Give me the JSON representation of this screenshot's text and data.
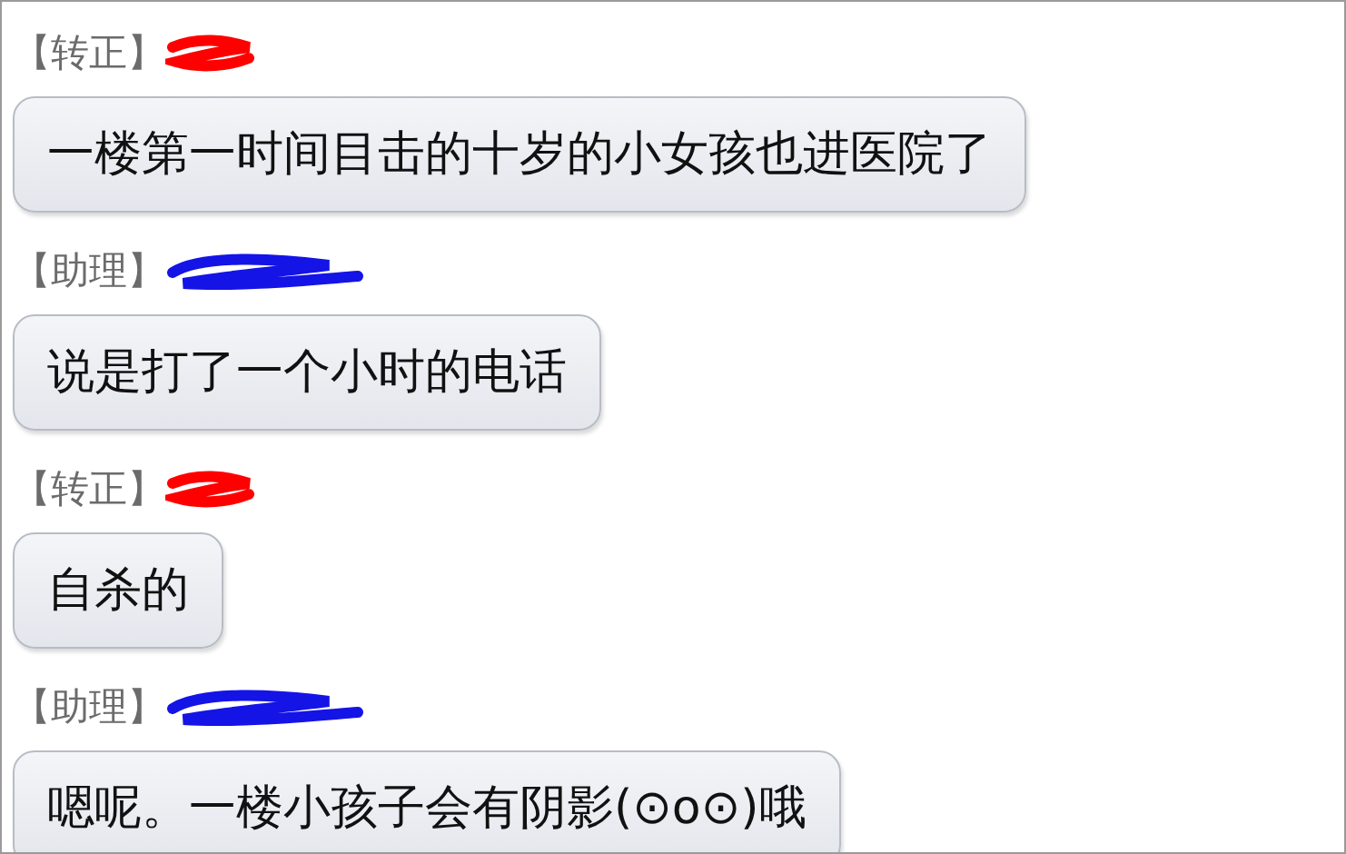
{
  "messages": [
    {
      "tag": "【转正】",
      "color": "#ff0000",
      "text": "一楼第一时间目击的十岁的小女孩也进医院了"
    },
    {
      "tag": "【助理】",
      "color": "#1414e6",
      "text": "说是打了一个小时的电话"
    },
    {
      "tag": "【转正】",
      "color": "#ff0000",
      "text": "自杀的"
    },
    {
      "tag": "【助理】",
      "color": "#1414e6",
      "text": "嗯呢。一楼小孩子会有阴影(⊙o⊙)哦"
    }
  ]
}
